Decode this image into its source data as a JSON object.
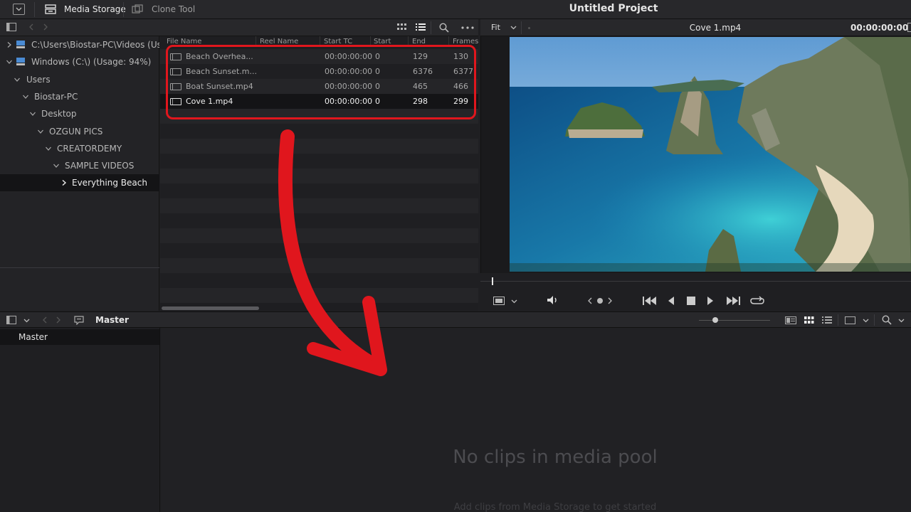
{
  "topbar": {
    "media_storage_label": "Media Storage",
    "clone_tool_label": "Clone Tool",
    "project_title": "Untitled Project"
  },
  "tree": {
    "items": [
      {
        "label": "C:\\Users\\Biostar-PC\\Videos (Us...",
        "level": 0,
        "expanded": false,
        "drive": true
      },
      {
        "label": "Windows (C:\\) (Usage: 94%)",
        "level": 0,
        "expanded": true,
        "drive": true
      },
      {
        "label": "Users",
        "level": 1,
        "expanded": true
      },
      {
        "label": "Biostar-PC",
        "level": 2,
        "expanded": true
      },
      {
        "label": "Desktop",
        "level": 3,
        "expanded": true
      },
      {
        "label": "OZGUN PICS",
        "level": 4,
        "expanded": true
      },
      {
        "label": "CREATORDEMY",
        "level": 5,
        "expanded": true
      },
      {
        "label": "SAMPLE VIDEOS",
        "level": 6,
        "expanded": true
      },
      {
        "label": "Everything Beach",
        "level": 7,
        "expanded": false,
        "selected": true
      }
    ]
  },
  "filelist": {
    "columns": [
      "File Name",
      "Reel Name",
      "Start TC",
      "Start",
      "End",
      "Frames"
    ],
    "rows": [
      {
        "name": "Beach Overhea...",
        "reel": "",
        "start_tc": "00:00:00:00",
        "start": "0",
        "end": "129",
        "frames": "130"
      },
      {
        "name": "Beach Sunset.m...",
        "reel": "",
        "start_tc": "00:00:00:00",
        "start": "0",
        "end": "6376",
        "frames": "6377"
      },
      {
        "name": "Boat Sunset.mp4",
        "reel": "",
        "start_tc": "00:00:00:00",
        "start": "0",
        "end": "465",
        "frames": "466"
      },
      {
        "name": "Cove 1.mp4",
        "reel": "",
        "start_tc": "00:00:00:00",
        "start": "0",
        "end": "298",
        "frames": "299",
        "selected": true
      }
    ]
  },
  "viewer": {
    "zoom": "Fit",
    "clip_name": "Cove 1.mp4",
    "timecode": "00:00:00:00"
  },
  "pool": {
    "breadcrumb": "Master",
    "bins": [
      "Master"
    ],
    "empty_title": "No clips in media pool",
    "empty_subtitle": "Add clips from Media Storage to get started"
  },
  "colors": {
    "annotation_red": "#e0161d",
    "panel_bg": "#1f1f22"
  }
}
